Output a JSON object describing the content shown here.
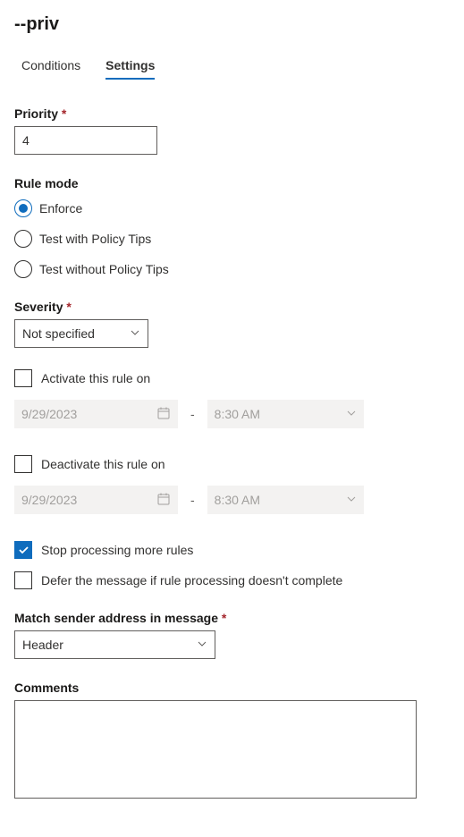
{
  "header": {
    "title": "--priv"
  },
  "tabs": {
    "items": [
      {
        "label": "Conditions",
        "active": false
      },
      {
        "label": "Settings",
        "active": true
      }
    ]
  },
  "priority": {
    "label": "Priority",
    "value": "4"
  },
  "rule_mode": {
    "label": "Rule mode",
    "options": [
      {
        "label": "Enforce",
        "checked": true
      },
      {
        "label": "Test with Policy Tips",
        "checked": false
      },
      {
        "label": "Test without Policy Tips",
        "checked": false
      }
    ]
  },
  "severity": {
    "label": "Severity",
    "value": "Not specified"
  },
  "activate": {
    "label": "Activate this rule on",
    "checked": false,
    "date": "9/29/2023",
    "time": "8:30 AM"
  },
  "deactivate": {
    "label": "Deactivate this rule on",
    "checked": false,
    "date": "9/29/2023",
    "time": "8:30 AM"
  },
  "stop_processing": {
    "label": "Stop processing more rules",
    "checked": true
  },
  "defer_message": {
    "label": "Defer the message if rule processing doesn't complete",
    "checked": false
  },
  "match_sender": {
    "label": "Match sender address in message",
    "value": "Header"
  },
  "comments": {
    "label": "Comments",
    "value": ""
  },
  "misc": {
    "dash": "-"
  }
}
